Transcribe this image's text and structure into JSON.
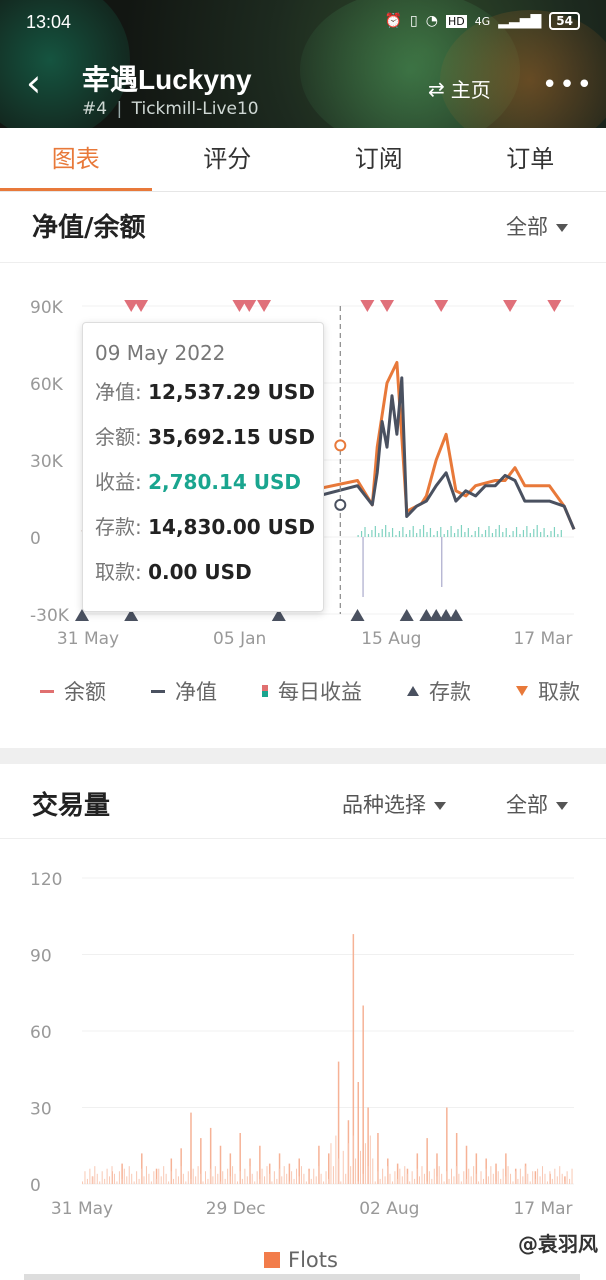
{
  "status_bar": {
    "time": "13:04",
    "network": "4G",
    "hd": "HD",
    "battery": "54"
  },
  "header": {
    "title": "幸遇Luckyny",
    "rank": "#4",
    "server": "Tickmill-Live10",
    "home_label": "主页"
  },
  "tabs": [
    "图表",
    "评分",
    "订阅",
    "订单"
  ],
  "equity_section": {
    "title": "净值/余额",
    "filter": "全部",
    "y_ticks": [
      "90K",
      "60K",
      "30K",
      "0",
      "-30K"
    ],
    "x_ticks": [
      "31 May",
      "05 Jan",
      "15 Aug",
      "17 Mar"
    ],
    "tooltip": {
      "date": "09 May 2022",
      "rows": [
        {
          "label": "净值:",
          "value": "12,537.29 USD",
          "color": "#222222"
        },
        {
          "label": "余额:",
          "value": "35,692.15 USD",
          "color": "#222222"
        },
        {
          "label": "收益:",
          "value": "2,780.14 USD",
          "color": "#1aa58f"
        },
        {
          "label": "存款:",
          "value": "14,830.00 USD",
          "color": "#222222"
        },
        {
          "label": "取款:",
          "value": "0.00 USD",
          "color": "#222222"
        }
      ]
    },
    "legend": [
      "余额",
      "净值",
      "每日收益",
      "存款",
      "取款"
    ]
  },
  "volume_section": {
    "title": "交易量",
    "symbol_filter": "品种选择",
    "filter": "全部",
    "y_ticks": [
      "120",
      "90",
      "60",
      "30",
      "0"
    ],
    "x_ticks": [
      "31 May",
      "29 Dec",
      "02 Aug",
      "17 Mar"
    ],
    "legend": "Flots"
  },
  "watermark": "@袁羽风",
  "chart_data": [
    {
      "type": "line",
      "title": "净值/余额",
      "ylim": [
        -30000,
        90000
      ],
      "x_ticks": [
        "31 May",
        "05 Jan",
        "15 Aug",
        "17 Mar"
      ],
      "series": [
        {
          "name": "余额",
          "color": "#e8793a",
          "x": [
            0.0,
            0.08,
            0.22,
            0.36,
            0.46,
            0.56,
            0.59,
            0.6,
            0.62,
            0.64,
            0.66,
            0.68,
            0.69,
            0.7,
            0.72,
            0.74,
            0.76,
            0.78,
            0.8,
            0.82,
            0.84,
            0.86,
            0.88,
            0.9,
            0.92,
            0.95,
            0.98,
            1.0
          ],
          "values": [
            2000,
            4000,
            6000,
            10000,
            18000,
            22000,
            12500,
            35000,
            60000,
            68000,
            10000,
            12000,
            13000,
            16000,
            30000,
            40000,
            18000,
            16000,
            20000,
            21000,
            22000,
            22000,
            27000,
            20000,
            20000,
            20000,
            12000,
            3000
          ]
        },
        {
          "name": "净值",
          "color": "#4a5160",
          "x": [
            0.0,
            0.08,
            0.22,
            0.36,
            0.46,
            0.56,
            0.59,
            0.6,
            0.61,
            0.62,
            0.63,
            0.64,
            0.65,
            0.66,
            0.67,
            0.68,
            0.7,
            0.72,
            0.74,
            0.76,
            0.78,
            0.8,
            0.82,
            0.84,
            0.86,
            0.88,
            0.9,
            0.92,
            0.95,
            0.98,
            1.0
          ],
          "values": [
            2000,
            4000,
            5000,
            8000,
            15000,
            20000,
            12537,
            25000,
            45000,
            35000,
            55000,
            40000,
            62000,
            8000,
            10000,
            12000,
            14000,
            20000,
            25000,
            14000,
            18000,
            16000,
            20000,
            20000,
            24000,
            22000,
            14000,
            14000,
            14000,
            12000,
            3000
          ]
        }
      ],
      "deposits_x": [
        0.0,
        0.1,
        0.4,
        0.56,
        0.66,
        0.7,
        0.72,
        0.74,
        0.76
      ],
      "withdrawals_x": [
        0.1,
        0.12,
        0.32,
        0.34,
        0.37,
        0.58,
        0.62,
        0.73,
        0.87,
        0.96
      ]
    },
    {
      "type": "bar",
      "title": "交易量",
      "ylim": [
        0,
        120
      ],
      "x_ticks": [
        "31 May",
        "29 Dec",
        "02 Aug",
        "17 Mar"
      ],
      "series": [
        {
          "name": "Flots",
          "color": "#f27c4a",
          "x": [
            0.02,
            0.06,
            0.08,
            0.12,
            0.15,
            0.18,
            0.2,
            0.22,
            0.24,
            0.26,
            0.28,
            0.3,
            0.32,
            0.34,
            0.36,
            0.38,
            0.4,
            0.42,
            0.44,
            0.46,
            0.48,
            0.5,
            0.52,
            0.54,
            0.55,
            0.56,
            0.57,
            0.58,
            0.6,
            0.62,
            0.64,
            0.66,
            0.68,
            0.7,
            0.72,
            0.74,
            0.76,
            0.78,
            0.8,
            0.82,
            0.84,
            0.86,
            0.88,
            0.9,
            0.92,
            0.95,
            0.98
          ],
          "values": [
            3,
            5,
            8,
            12,
            6,
            10,
            14,
            28,
            18,
            22,
            15,
            12,
            20,
            10,
            15,
            8,
            12,
            8,
            10,
            6,
            15,
            12,
            48,
            25,
            98,
            40,
            70,
            30,
            20,
            10,
            8,
            6,
            12,
            18,
            12,
            30,
            20,
            15,
            12,
            10,
            8,
            12,
            6,
            8,
            5,
            4,
            3
          ]
        }
      ]
    }
  ]
}
